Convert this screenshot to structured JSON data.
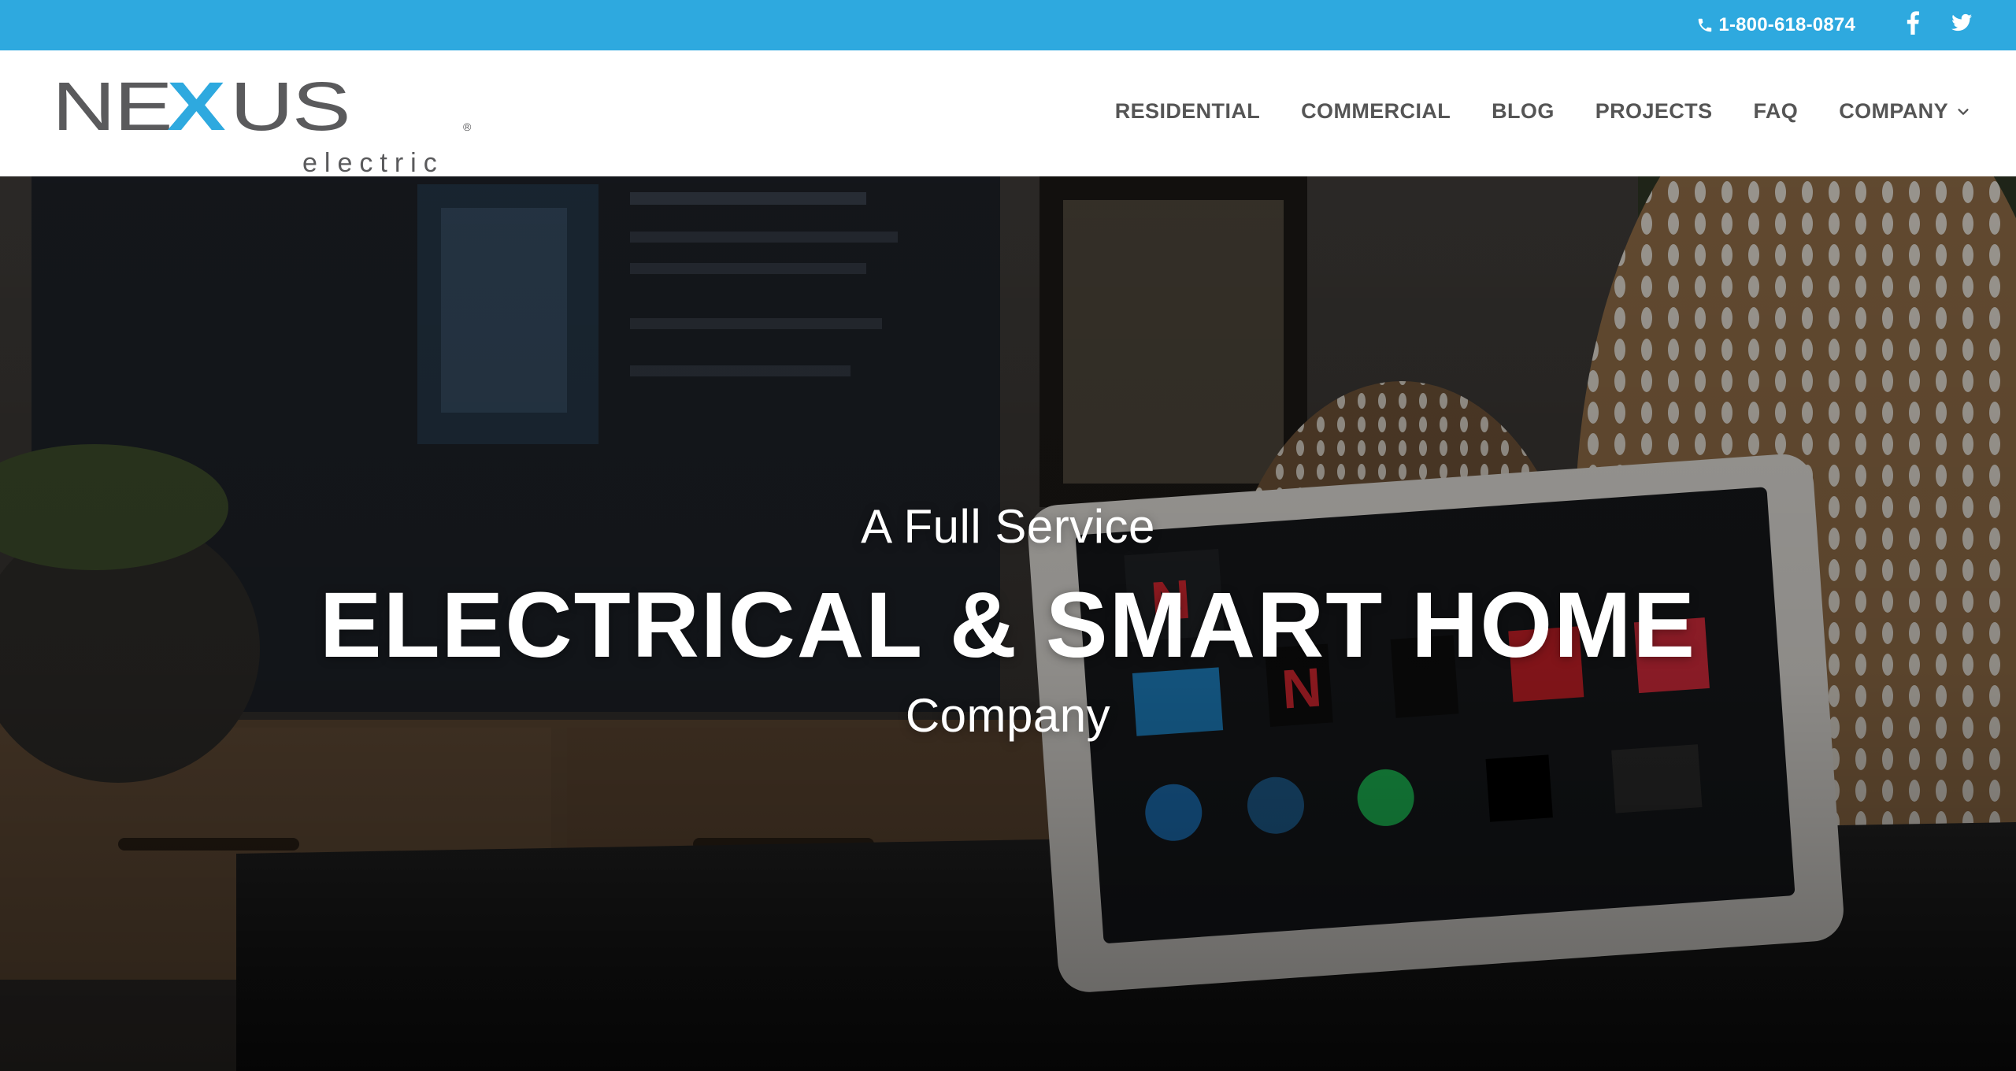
{
  "topbar": {
    "phone": "1-800-618-0874",
    "icons": {
      "phone": "phone-icon",
      "facebook": "facebook-icon",
      "twitter": "twitter-icon"
    },
    "background": "#2ea9df"
  },
  "brand": {
    "name_left": "NE",
    "name_x": "X",
    "name_right": "US",
    "tagline": "electric",
    "registered": "®",
    "colors": {
      "gray": "#5a5a5c",
      "blue": "#2ea9df"
    }
  },
  "nav": {
    "items": [
      {
        "label": "RESIDENTIAL"
      },
      {
        "label": "COMMERCIAL"
      },
      {
        "label": "BLOG"
      },
      {
        "label": "PROJECTS"
      },
      {
        "label": "FAQ"
      },
      {
        "label": "COMPANY",
        "has_dropdown": true
      }
    ]
  },
  "hero": {
    "pre": "A Full Service",
    "main": "ELECTRICAL & SMART HOME",
    "post": "Company"
  }
}
